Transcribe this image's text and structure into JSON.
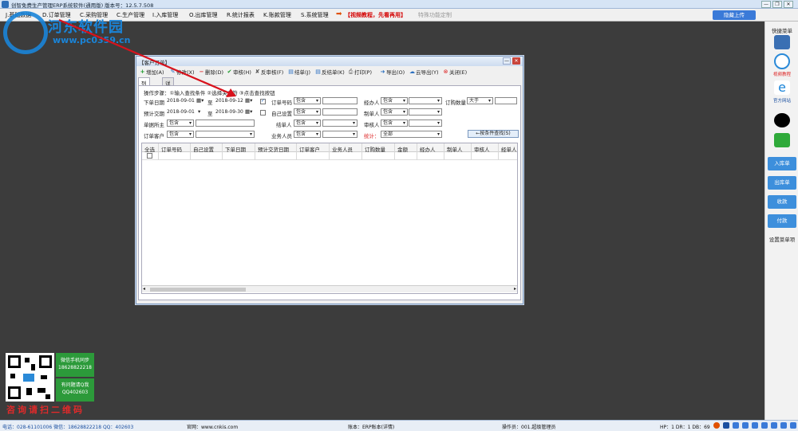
{
  "window": {
    "title": "创智免费生产管理ERP系统软件(通用版) 版本号：12.5.7.508",
    "controls": [
      "—",
      "❐",
      "✕"
    ]
  },
  "menu": {
    "items": [
      "J.基础数据",
      "D.订单管理",
      "C.采购管理",
      "C.生产管理",
      "I.入库管理",
      "O.出库管理",
      "R.统计报表",
      "K.账款管理",
      "S.系统管理"
    ],
    "video": "【视频教程，先看再用】",
    "custom": "特殊功能定制",
    "cloud": "隐藏上传"
  },
  "watermark": {
    "name": "河东软件园",
    "url": "www.pc0359.cn"
  },
  "right_panel": {
    "header": "快捷菜单",
    "video_label": "视频教程",
    "site_label": "官方网站",
    "buttons": [
      "入库单",
      "出库单",
      "收款",
      "付款"
    ],
    "settings": "设置菜单项"
  },
  "qr": {
    "line1": "微信手机同步",
    "line2": "18628822218",
    "line3": "有问题请Q我",
    "line4": "QQ402603",
    "consult": "咨询请扫二维码"
  },
  "status": {
    "contact": "电话：028-61101006 微信：18628822218 QQ：402603",
    "site": "官网：www.cnkis.com",
    "account": "账本：ERP账本(详情)",
    "operator": "操作员：001.超级管理员",
    "db": "HP：1 DR：1 DB：69"
  },
  "dialog": {
    "title": "【客户订单】",
    "toolbar": [
      "增加(A)",
      "修改(X)",
      "删除(D)",
      "审核(H)",
      "反审核(F)",
      "结单(J)",
      "反结单(K)",
      "打印(P)",
      "导出(O)",
      "云导出(Y)",
      "关闭(E)"
    ],
    "tabs": [
      "列表信息",
      "详细信息"
    ],
    "steps": "操作步骤：①输入查找条件 ②选择关系符 ③点击查找按钮",
    "form": {
      "order_date_label": "下单日期",
      "order_date_from": "2018-09-01",
      "order_date_to": "2018-09-12",
      "to": "至",
      "delivery_label": "预计交期",
      "delivery_from": "2018-09-01",
      "delivery_to": "2018-09-30",
      "holder_label": "单据所主",
      "customer_label": "订单客户",
      "order_no_label": "订单号码",
      "self_set_label": "自己设置",
      "settle_label": "结单人",
      "sales_label": "业务人员",
      "handler_label": "经办人",
      "maker_label": "制单人",
      "auditor_label": "审核人",
      "stat_label": "统计：",
      "qty_label": "订购数量",
      "qty_op": "大于",
      "contains": "包含",
      "all": "全部",
      "search_btn": "←按条件查找(S)"
    },
    "grid_headers": [
      "全选",
      "订单号码",
      "自己设置",
      "下单日期",
      "预计交货日期",
      "订单客户",
      "业务人员",
      "订购数量",
      "金额",
      "经办人",
      "制单人",
      "审核人",
      "经单人"
    ]
  }
}
